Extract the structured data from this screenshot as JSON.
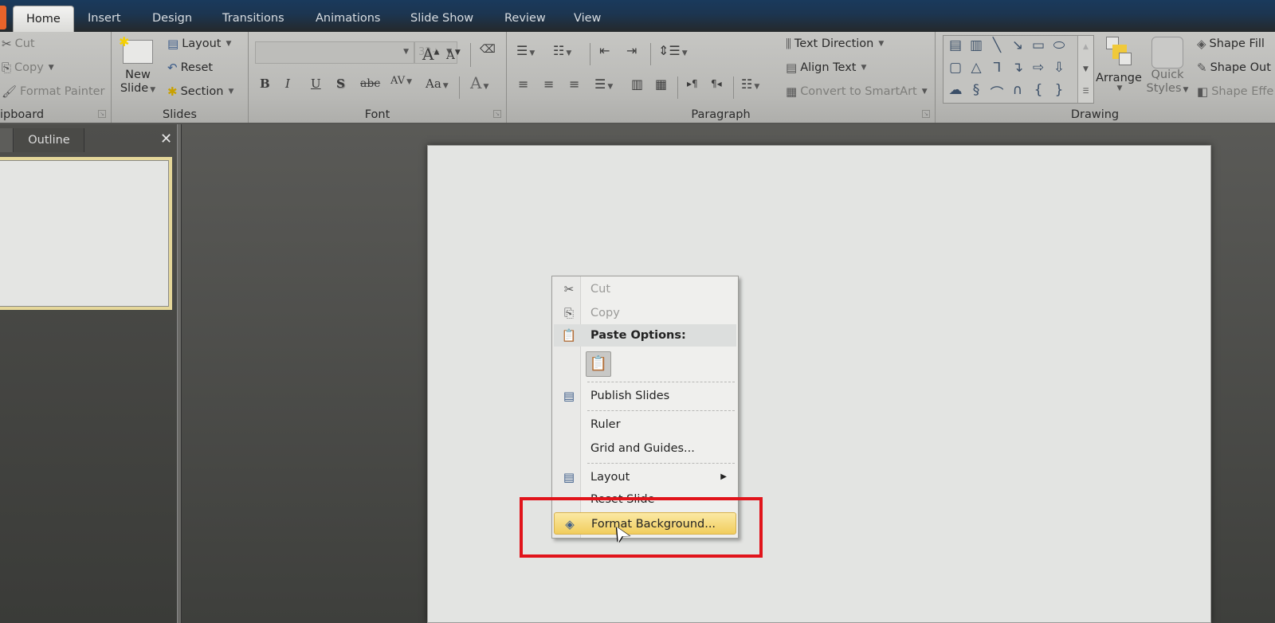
{
  "tabs": [
    {
      "label": "Home",
      "active": true
    },
    {
      "label": "Insert"
    },
    {
      "label": "Design"
    },
    {
      "label": "Transitions"
    },
    {
      "label": "Animations"
    },
    {
      "label": "Slide Show"
    },
    {
      "label": "Review"
    },
    {
      "label": "View"
    }
  ],
  "ribbon": {
    "clipboard": {
      "label": "ipboard",
      "cut": "Cut",
      "copy": "Copy",
      "format_painter": "Format Painter"
    },
    "slides": {
      "label": "Slides",
      "new_slide_line1": "New",
      "new_slide_line2": "Slide",
      "layout": "Layout",
      "reset": "Reset",
      "section": "Section"
    },
    "font": {
      "label": "Font",
      "font_name": "",
      "font_size": "32+",
      "bold": "B",
      "italic": "I",
      "underline": "U",
      "shadow": "S",
      "strike": "abc",
      "spacing": "AV",
      "case": "Aa",
      "color": "A",
      "grow": "A",
      "shrink": "A"
    },
    "paragraph": {
      "label": "Paragraph",
      "text_direction": "Text Direction",
      "align_text": "Align Text",
      "convert_smartart": "Convert to SmartArt"
    },
    "drawing": {
      "label": "Drawing",
      "arrange": "Arrange",
      "quick_styles_line1": "Quick",
      "quick_styles_line2": "Styles",
      "shape_fill": "Shape Fill",
      "shape_outline": "Shape Out",
      "shape_effects": "Shape Effe"
    }
  },
  "left_pane": {
    "outline_tab": "Outline",
    "close": "✕"
  },
  "context_menu": {
    "items": [
      {
        "label": "Cut",
        "disabled": true,
        "icon": "scissors-icon"
      },
      {
        "label": "Copy",
        "disabled": true,
        "icon": "copy-icon"
      },
      {
        "label": "Paste Options:",
        "header": true,
        "icon": "paste-icon"
      },
      {
        "label": "Publish Slides",
        "icon": "publish-slides-icon"
      },
      {
        "label": "Ruler"
      },
      {
        "label": "Grid and Guides..."
      },
      {
        "label": "Layout",
        "submenu": true,
        "icon": "layout-icon"
      },
      {
        "label": "Reset Slide"
      },
      {
        "label": "Format Background...",
        "hover": true,
        "icon": "format-background-icon"
      }
    ]
  },
  "colors": {
    "highlight": "#e1141b",
    "accent": "#f1cd5d"
  }
}
